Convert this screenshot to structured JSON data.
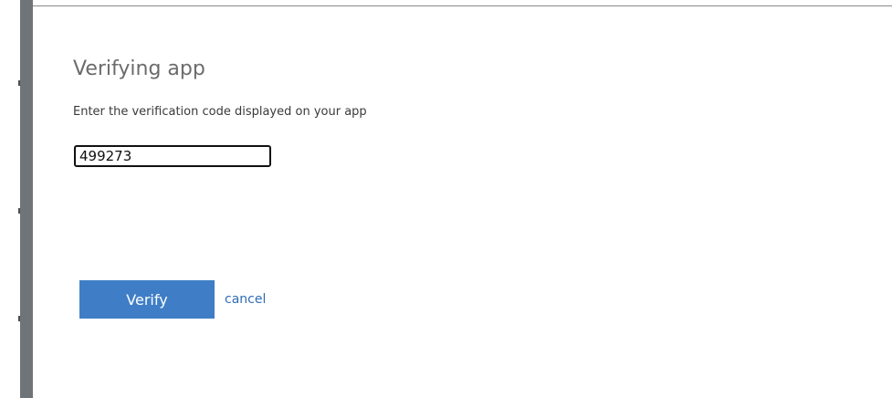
{
  "dialog": {
    "title": "Verifying app",
    "instruction": "Enter the verification code displayed on your app",
    "code_input": {
      "value": "499273",
      "placeholder": ""
    },
    "verify_label": "Verify",
    "cancel_label": "cancel"
  },
  "colors": {
    "primary_button": "#3f7ec7",
    "link": "#2f6db5",
    "side_bar": "#6f7479"
  }
}
